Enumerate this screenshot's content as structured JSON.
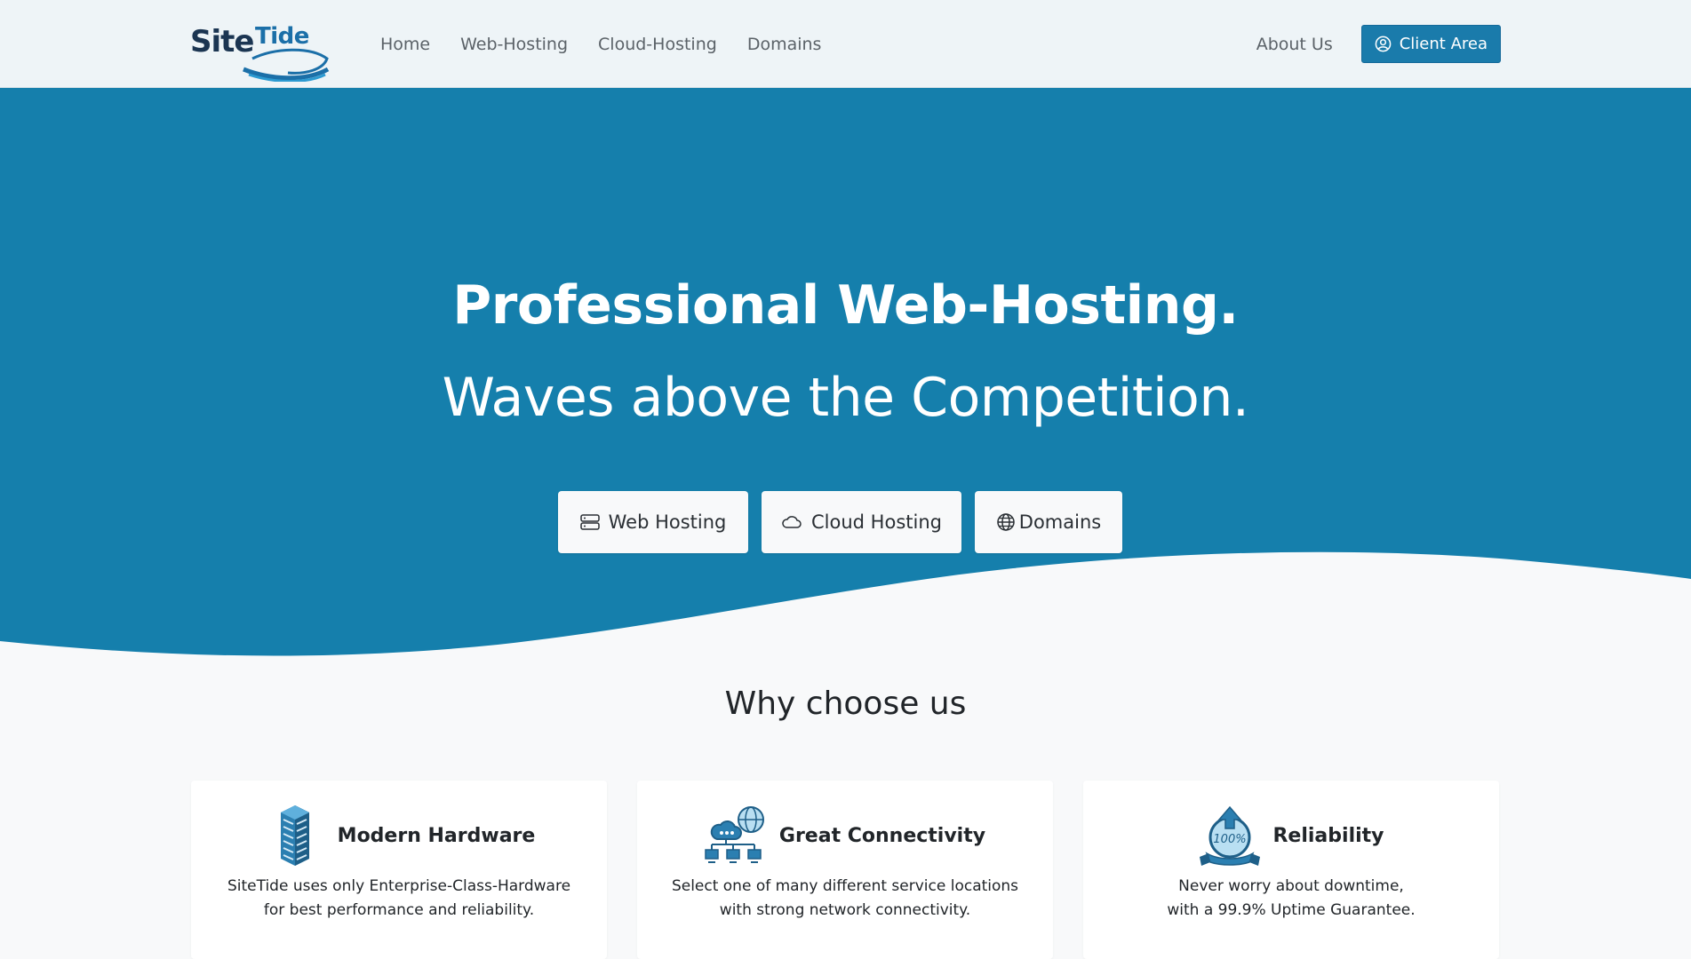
{
  "header": {
    "logo": {
      "site": "Site",
      "tide": "Tide"
    },
    "nav": [
      "Home",
      "Web-Hosting",
      "Cloud-Hosting",
      "Domains"
    ],
    "about_label": "About Us",
    "client_area_label": "Client Area",
    "accent_color": "#1a7bab"
  },
  "hero": {
    "title": "Professional Web-Hosting.",
    "subtitle": "Waves above the Competition.",
    "background_color": "#157fac",
    "buttons": [
      {
        "label": "Web Hosting",
        "icon": "server-icon"
      },
      {
        "label": "Cloud Hosting",
        "icon": "cloud-icon"
      },
      {
        "label": "Domains",
        "icon": "globe-icon"
      }
    ]
  },
  "why": {
    "title": "Why choose us",
    "cards": [
      {
        "icon": "server-rack-icon",
        "title": "Modern Hardware",
        "line1": "SiteTide uses only Enterprise-Class-Hardware",
        "line2": "for best performance and reliability."
      },
      {
        "icon": "network-globe-icon",
        "title": "Great Connectivity",
        "line1": "Select one of many different service locations",
        "line2": "with strong network connectivity."
      },
      {
        "icon": "uptime-badge-icon",
        "title": "Reliability",
        "line1": "Never worry about downtime,",
        "line2": "with a 99.9% Uptime Guarantee.",
        "badge_text": "100%"
      }
    ]
  }
}
